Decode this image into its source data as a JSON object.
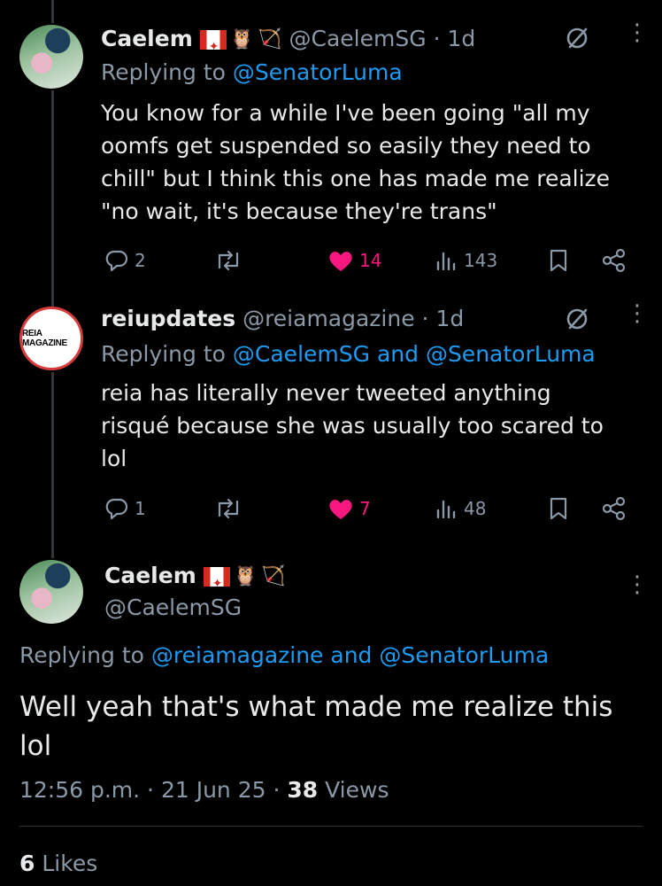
{
  "tweets": [
    {
      "display_name": "Caelem",
      "emojis": [
        "🦉",
        "🏹"
      ],
      "handle": "@CaelemSG",
      "time": "1d",
      "replying_to_label": "Replying to",
      "replying_to_1": "@SenatorLuma",
      "body_lines": [
        "You know for a while I've been going \"all my",
        "oomfs get suspended so easily they need to",
        "chill\" but I think this one has made me realize",
        "\"no wait, it's because they're trans\""
      ],
      "replies": "2",
      "likes": "14",
      "views": "143"
    },
    {
      "display_name": "reiupdates",
      "avatar_text": "REIA MAGAZINE",
      "handle": "@reiamagazine",
      "time": "1d",
      "replying_to_label": "Replying to",
      "replying_to_1": "@CaelemSG",
      "replying_and": "and",
      "replying_to_2": "@SenatorLuma",
      "body_lines": [
        "reia has literally never tweeted anything",
        "risqué because she was usually too scared to",
        "lol"
      ],
      "replies": "1",
      "likes": "7",
      "views": "48"
    }
  ],
  "main": {
    "display_name": "Caelem",
    "emojis": [
      "🦉",
      "🏹"
    ],
    "handle": "@CaelemSG",
    "replying_to_label": "Replying to",
    "replying_to_1": "@reiamagazine",
    "replying_and": "and",
    "replying_to_2": "@SenatorLuma",
    "body_lines": [
      "Well yeah that's what made me realize this",
      "lol"
    ],
    "timestamp": "12:56 p.m. · 21 Jun 25 ·",
    "views_count": "38",
    "views_label": "Views",
    "likes_count": "6",
    "likes_label": "Likes"
  },
  "colors": {
    "link": "#1d9bf0",
    "like": "#f91880",
    "muted": "#8b98a5",
    "background": "#000000"
  },
  "icons": [
    "reply-icon",
    "retweet-icon",
    "heart-icon",
    "views-icon",
    "bookmark-icon",
    "share-icon",
    "grok-icon",
    "more-icon"
  ]
}
